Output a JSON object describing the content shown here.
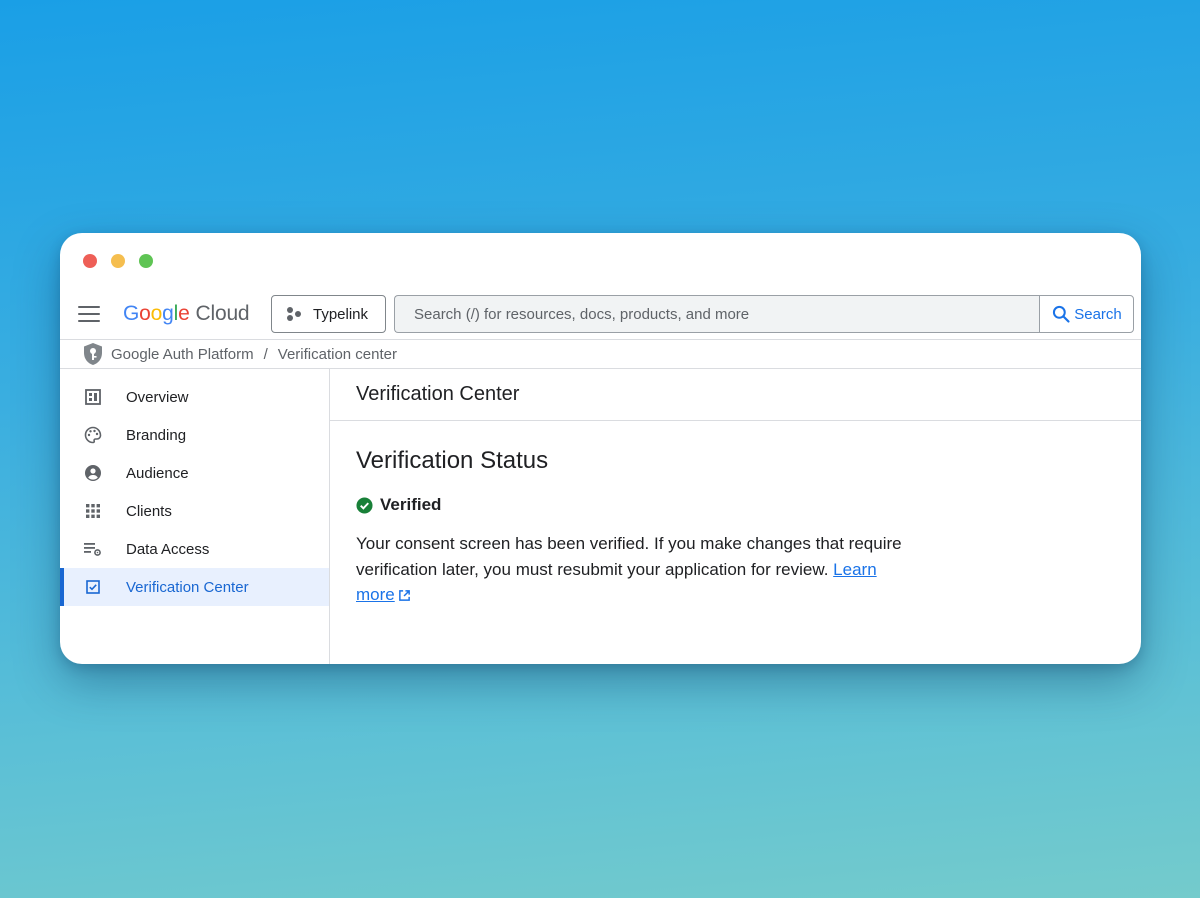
{
  "window": {
    "controls": [
      "close",
      "minimize",
      "maximize"
    ]
  },
  "header": {
    "logo_google": [
      "G",
      "o",
      "o",
      "g",
      "l",
      "e"
    ],
    "logo_cloud": "Cloud",
    "project_label": "Typelink",
    "search_placeholder": "Search (/) for resources, docs, products, and more",
    "search_button_label": "Search"
  },
  "breadcrumb": {
    "product": "Google Auth Platform",
    "separator": "/",
    "page": "Verification center"
  },
  "sidebar": {
    "items": [
      {
        "label": "Overview",
        "icon": "dashboard-icon"
      },
      {
        "label": "Branding",
        "icon": "palette-icon"
      },
      {
        "label": "Audience",
        "icon": "person-circle-icon"
      },
      {
        "label": "Clients",
        "icon": "grid-icon"
      },
      {
        "label": "Data Access",
        "icon": "list-settings-icon"
      },
      {
        "label": "Verification Center",
        "icon": "checkbox-icon",
        "active": true
      }
    ]
  },
  "main": {
    "page_title": "Verification Center",
    "section_title": "Verification Status",
    "status_label": "Verified",
    "description": "Your consent screen has been verified. If you make changes that require verification later, you must resubmit your application for review.",
    "learn_more_label": "Learn more"
  },
  "colors": {
    "accent": "#1a73e8",
    "active_nav_bg": "#e8f0fe",
    "verified_green": "#188038"
  }
}
